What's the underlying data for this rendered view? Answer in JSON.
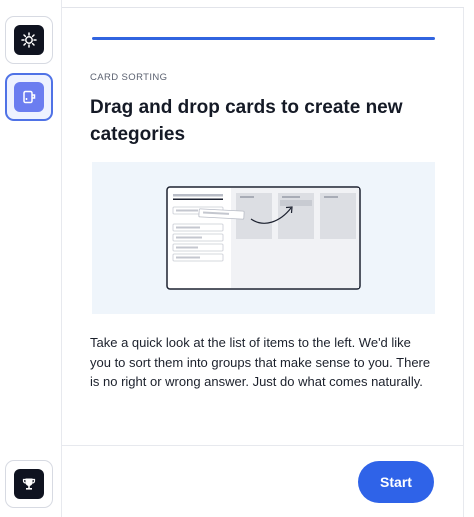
{
  "rail": {
    "items": [
      {
        "icon": "gear-icon",
        "active": false
      },
      {
        "icon": "card-sorting-icon",
        "active": true
      }
    ],
    "bottom_icon": "trophy-icon"
  },
  "task": {
    "progress_percent": 100,
    "eyebrow": "CARD SORTING",
    "title": "Drag and drop cards to create new categories",
    "description": "Take a quick look at the list of items to the left. We'd like you to sort them into groups that make sense to you. There is no right or wrong answer. Just do what comes naturally.",
    "start_label": "Start"
  },
  "colors": {
    "accent": "#2f63e8",
    "illustration_bg": "#eff5fb",
    "rail_tile": "#0f1320"
  }
}
